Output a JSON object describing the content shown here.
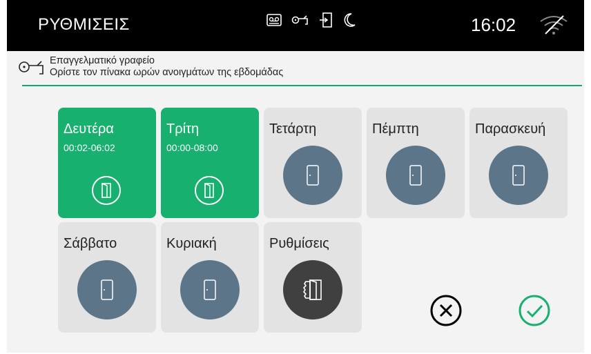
{
  "topbar": {
    "title": "ΡΥΘΜΙΣΕΙΣ",
    "status_icons": [
      "voicemail-icon",
      "key-icon",
      "door-exit-icon",
      "moon-icon"
    ],
    "clock": "16:02",
    "wifi_icon": "wifi-off-icon"
  },
  "subheader": {
    "icon": "key-icon",
    "line1": "Επαγγελματικό γραφείο",
    "line2": "Ορίστε τον πίνακα ωρών ανοιγμάτων της εβδομάδας"
  },
  "days": [
    {
      "label": "Δευτέρα",
      "time": "00:02-06:02",
      "active": true
    },
    {
      "label": "Τρίτη",
      "time": "00:00-08:00",
      "active": true
    },
    {
      "label": "Τετάρτη",
      "time": "",
      "active": false
    },
    {
      "label": "Πέμπτη",
      "time": "",
      "active": false
    },
    {
      "label": "Παρασκευή",
      "time": "",
      "active": false
    },
    {
      "label": "Σάββατο",
      "time": "",
      "active": false
    },
    {
      "label": "Κυριακή",
      "time": "",
      "active": false
    }
  ],
  "settings_tile": {
    "label": "Ρυθμίσεις",
    "icon": "door-gear-icon"
  },
  "actions": {
    "cancel_icon": "cancel-icon",
    "confirm_icon": "confirm-icon"
  },
  "colors": {
    "accent": "#17b06f",
    "tile_bg": "#e3e3e3",
    "circle": "#5c7589",
    "circle_dark": "#404040",
    "topbar": "#000000"
  }
}
